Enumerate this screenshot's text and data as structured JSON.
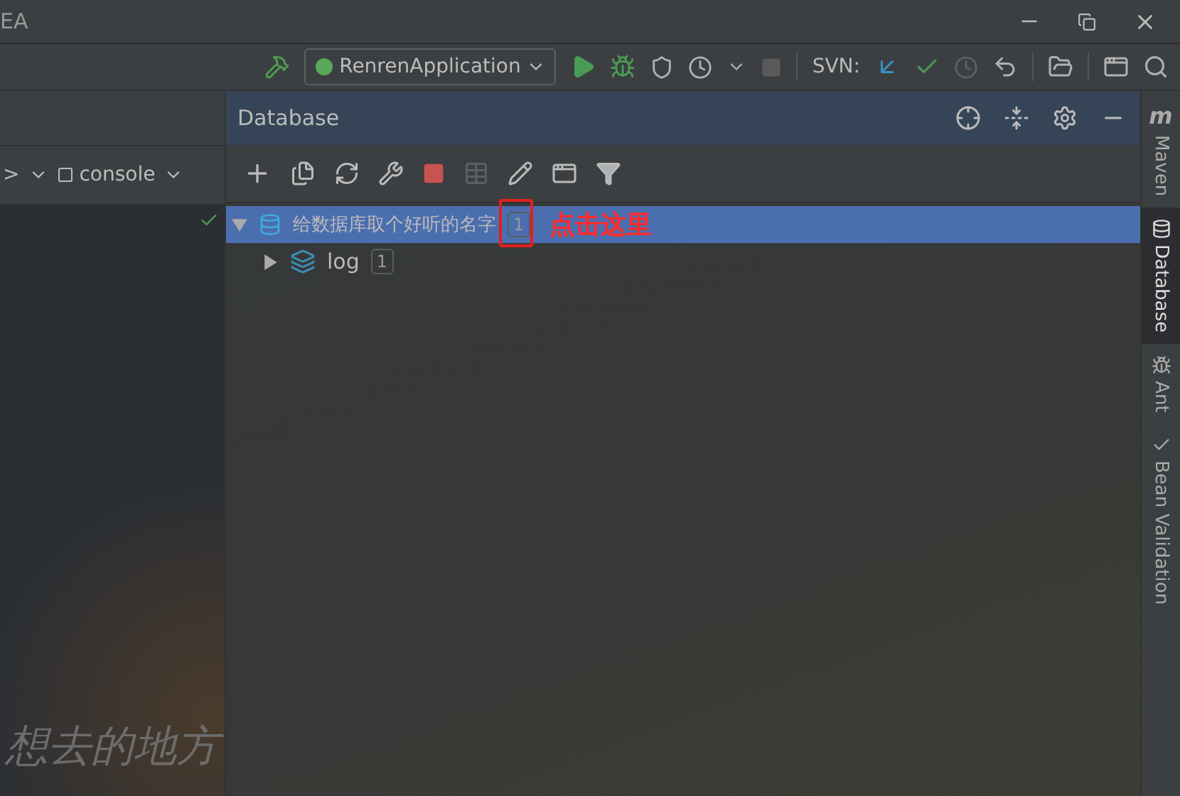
{
  "window": {
    "title": "EA"
  },
  "toolbar": {
    "run_config": "RenrenApplication",
    "vcs_label": "SVN:"
  },
  "left_panel": {
    "tab_prefix": ">",
    "console_tab": "console",
    "background_text": "想去的地方"
  },
  "database_panel": {
    "title": "Database",
    "tree": [
      {
        "kind": "datasource",
        "label": "给数据库取个好听的名字",
        "badge": "1",
        "selected": true,
        "expanded": true,
        "highlighted": true,
        "children": [
          {
            "kind": "schema",
            "label": "log",
            "badge": "1",
            "selected": false,
            "expanded": false,
            "highlighted": false
          }
        ]
      }
    ]
  },
  "annotation": {
    "text": "点击这里"
  },
  "right_strip": {
    "tabs": [
      {
        "kind": "maven",
        "icon_glyph": "m",
        "label": "Maven",
        "selected": false
      },
      {
        "kind": "database",
        "label": "Database",
        "selected": true
      },
      {
        "kind": "ant",
        "label": "Ant",
        "selected": false
      },
      {
        "kind": "bean",
        "label": "Bean Validation",
        "selected": false
      }
    ]
  }
}
